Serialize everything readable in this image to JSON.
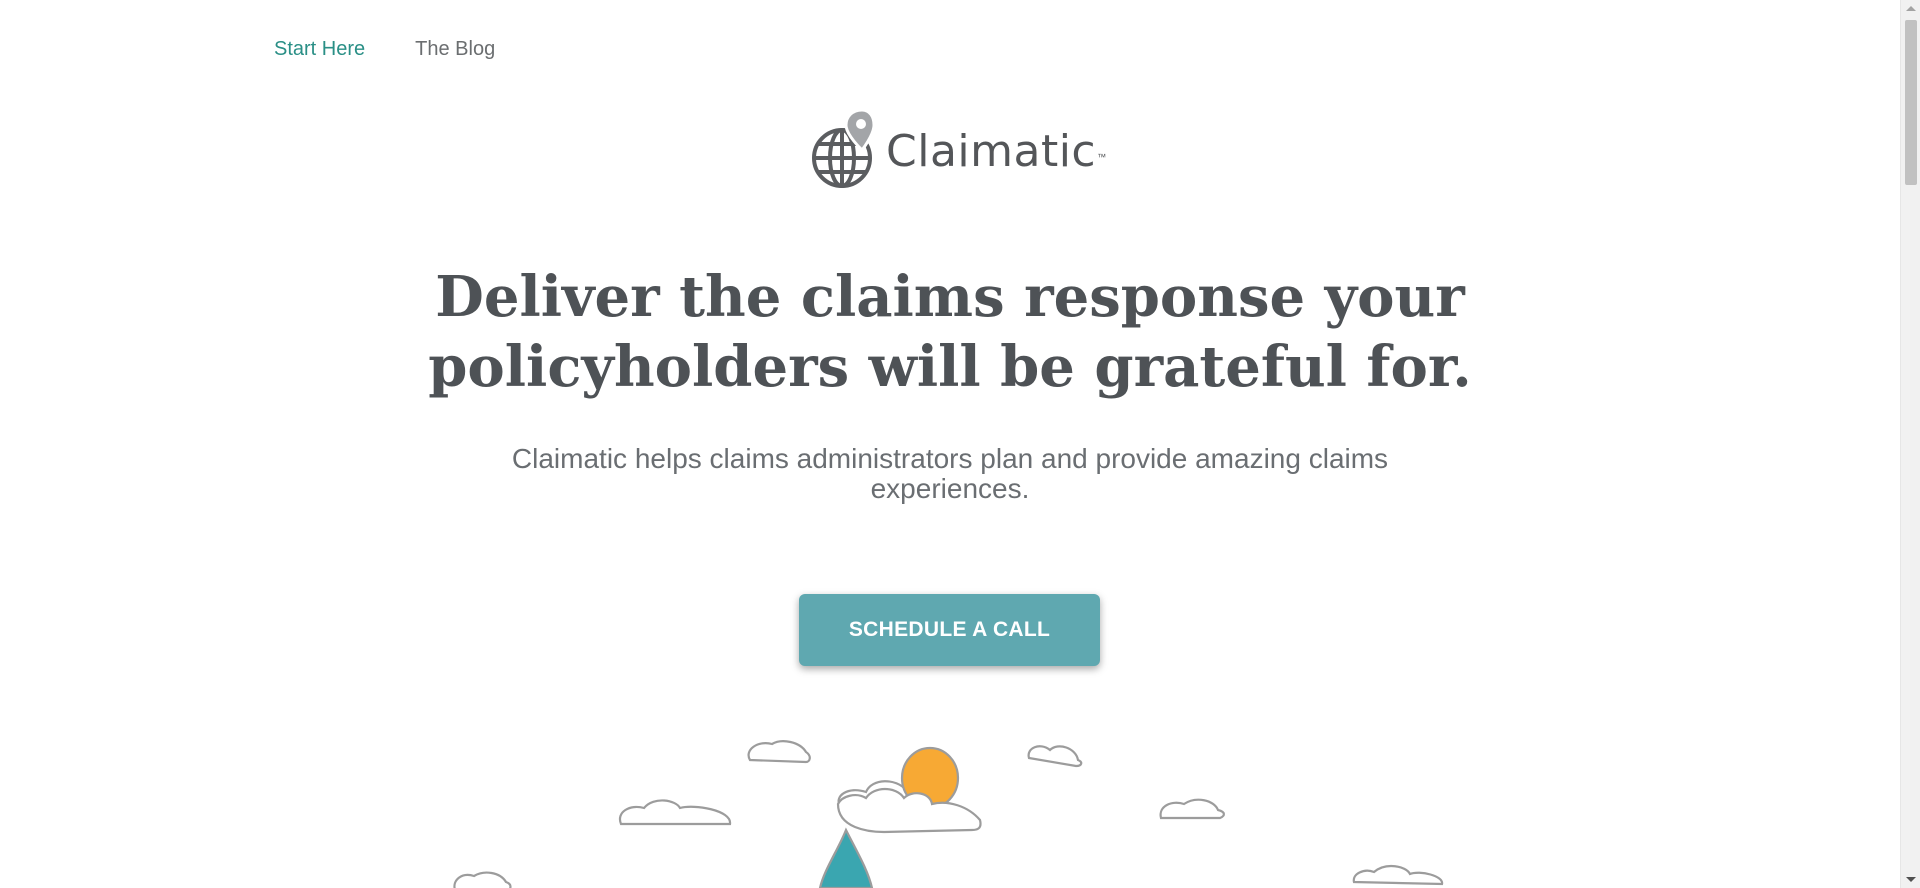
{
  "nav": {
    "items": [
      {
        "label": "Start Here",
        "active": true
      },
      {
        "label": "The Blog",
        "active": false
      }
    ]
  },
  "logo": {
    "text": "Claimatic",
    "trademark": "™",
    "icon": "globe-location-pin-icon"
  },
  "hero": {
    "headline_line1": "Deliver the claims response your",
    "headline_line2": "policyholders will be grateful for.",
    "subheadline": "Claimatic helps claims administrators plan and provide amazing claims experiences.",
    "cta_label": "SCHEDULE A CALL"
  },
  "illustration": {
    "elements": [
      "cloud-icon",
      "sun-icon",
      "rocket-icon"
    ]
  },
  "colors": {
    "accent": "#2a8f86",
    "nav_inactive": "#6b6e70",
    "headline": "#4e5256",
    "subheadline": "#6a6e72",
    "cta_background": "#5fa8b0",
    "sun": "#f7a934",
    "rocket": "#3aa6b0"
  }
}
